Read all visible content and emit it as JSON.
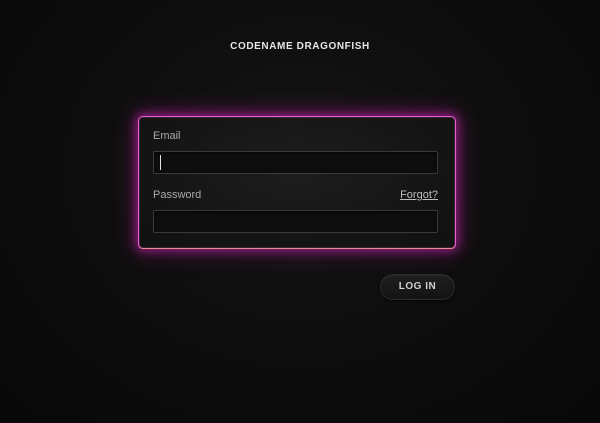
{
  "app": {
    "title": "CODENAME DRAGONFISH"
  },
  "form": {
    "email_label": "Email",
    "email_value": "",
    "email_placeholder": "",
    "password_label": "Password",
    "password_value": "",
    "password_placeholder": "",
    "forgot_label": "Forgot?",
    "login_label": "LOG IN"
  },
  "colors": {
    "background": "#0b0b0b",
    "panel_glow": "#e85bd0",
    "panel_glow_bottom": "#f08a9a",
    "text": "#e6e6e6"
  }
}
